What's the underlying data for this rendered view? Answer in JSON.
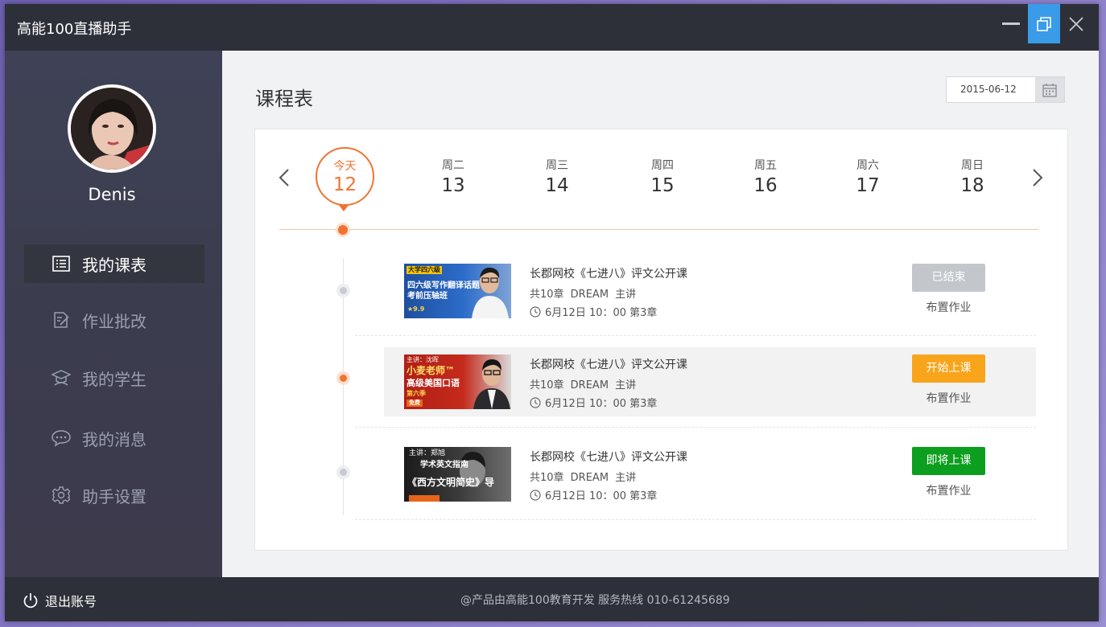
{
  "window": {
    "title": "高能100直播助手"
  },
  "sidebar": {
    "username": "Denis",
    "items": [
      {
        "label": "我的课表",
        "icon": "schedule-list-icon",
        "active": true
      },
      {
        "label": "作业批改",
        "icon": "edit-document-icon",
        "active": false
      },
      {
        "label": "我的学生",
        "icon": "graduation-cap-icon",
        "active": false
      },
      {
        "label": "我的消息",
        "icon": "chat-bubble-icon",
        "active": false
      },
      {
        "label": "助手设置",
        "icon": "gear-icon",
        "active": false
      }
    ]
  },
  "main": {
    "title": "课程表",
    "date": "2015-06-12",
    "week": [
      {
        "name": "今天",
        "num": "12",
        "today": true
      },
      {
        "name": "周二",
        "num": "13"
      },
      {
        "name": "周三",
        "num": "14"
      },
      {
        "name": "周四",
        "num": "15"
      },
      {
        "name": "周五",
        "num": "16"
      },
      {
        "name": "周六",
        "num": "17"
      },
      {
        "name": "周日",
        "num": "18"
      }
    ],
    "courses": [
      {
        "title": "长郡网校《七进八》评文公开课",
        "meta": "共10章 DREAM 主讲",
        "time": "6月12日 10：00 第3章",
        "status": "已结束",
        "status_color": "#c3c7cc",
        "homework": "布置作业",
        "thumb_lines": [
          "大学四六级",
          "四六级写作翻译话题",
          "考前压轴班",
          "★9.9"
        ]
      },
      {
        "title": "长郡网校《七进八》评文公开课",
        "meta": "共10章 DREAM 主讲",
        "time": "6月12日 10：00 第3章",
        "status": "开始上课",
        "status_color": "#f8a51c",
        "homework": "布置作业",
        "thumb_lines": [
          "主讲：沈晖",
          "小麦老师™",
          "高级美国口语",
          "第六季",
          "免费"
        ]
      },
      {
        "title": "长郡网校《七进八》评文公开课",
        "meta": "共10章 DREAM 主讲",
        "time": "6月12日 10：00 第3章",
        "status": "即将上课",
        "status_color": "#0c9e1e",
        "homework": "布置作业",
        "thumb_lines": [
          "主讲：郑旭",
          "学术英文指南",
          "《西方文明简史》导"
        ]
      }
    ]
  },
  "footer": {
    "logout": "退出账号",
    "text": "@产品由高能100教育开发 服务热线 010-61245689"
  },
  "colors": {
    "accent": "#f07330",
    "titlebar": "#2d3038",
    "maximize": "#3a9be8"
  }
}
